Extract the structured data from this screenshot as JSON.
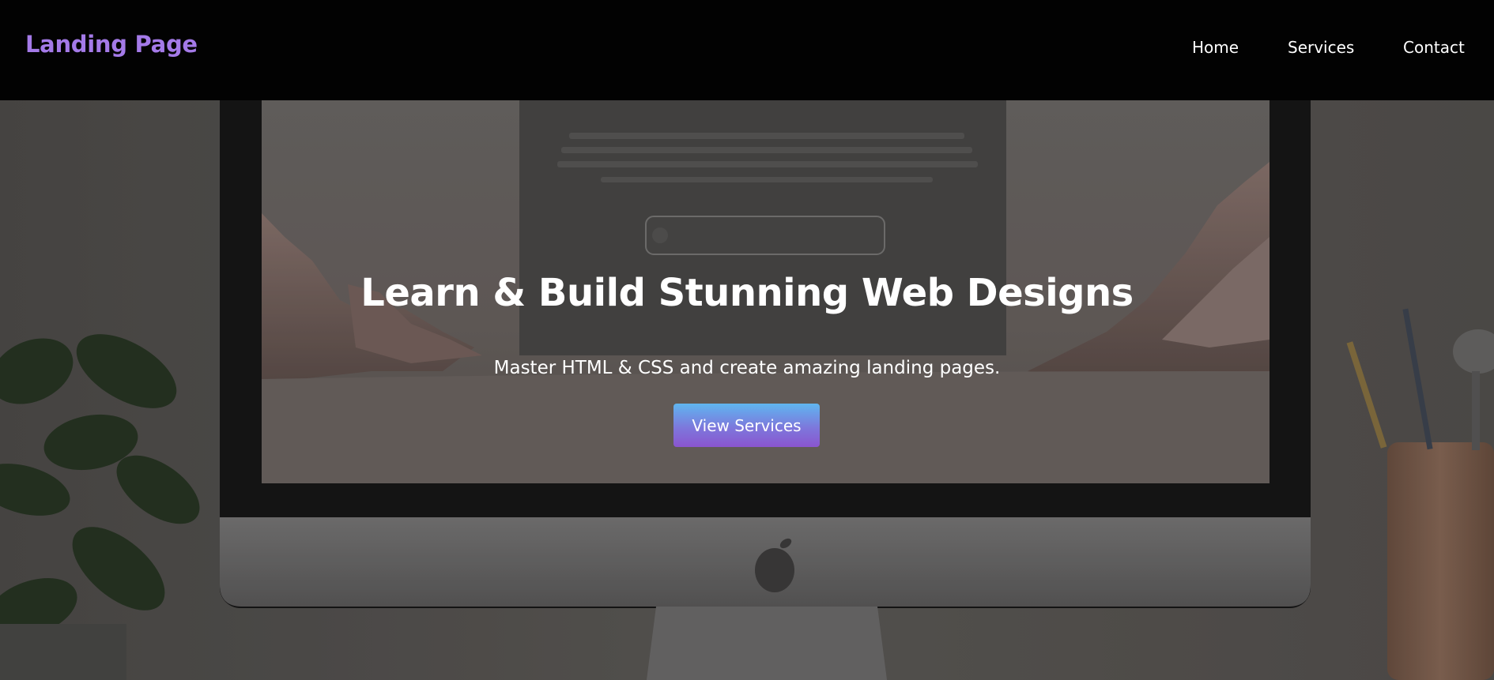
{
  "header": {
    "brand": "Landing Page",
    "nav": [
      {
        "label": "Home"
      },
      {
        "label": "Services"
      },
      {
        "label": "Contact"
      }
    ]
  },
  "hero": {
    "title": "Learn & Build Stunning Web Designs",
    "subtitle": "Master HTML & CSS and create amazing landing pages.",
    "cta_label": "View Services",
    "background": "photo-of-desktop-monitor-with-plant-and-pencil-cup"
  },
  "colors": {
    "brand": "#a47ae8",
    "header_bg": "#020202",
    "cta_gradient_top": "#5fb6f0",
    "cta_gradient_bottom": "#8a55cf",
    "text": "#ffffff"
  }
}
